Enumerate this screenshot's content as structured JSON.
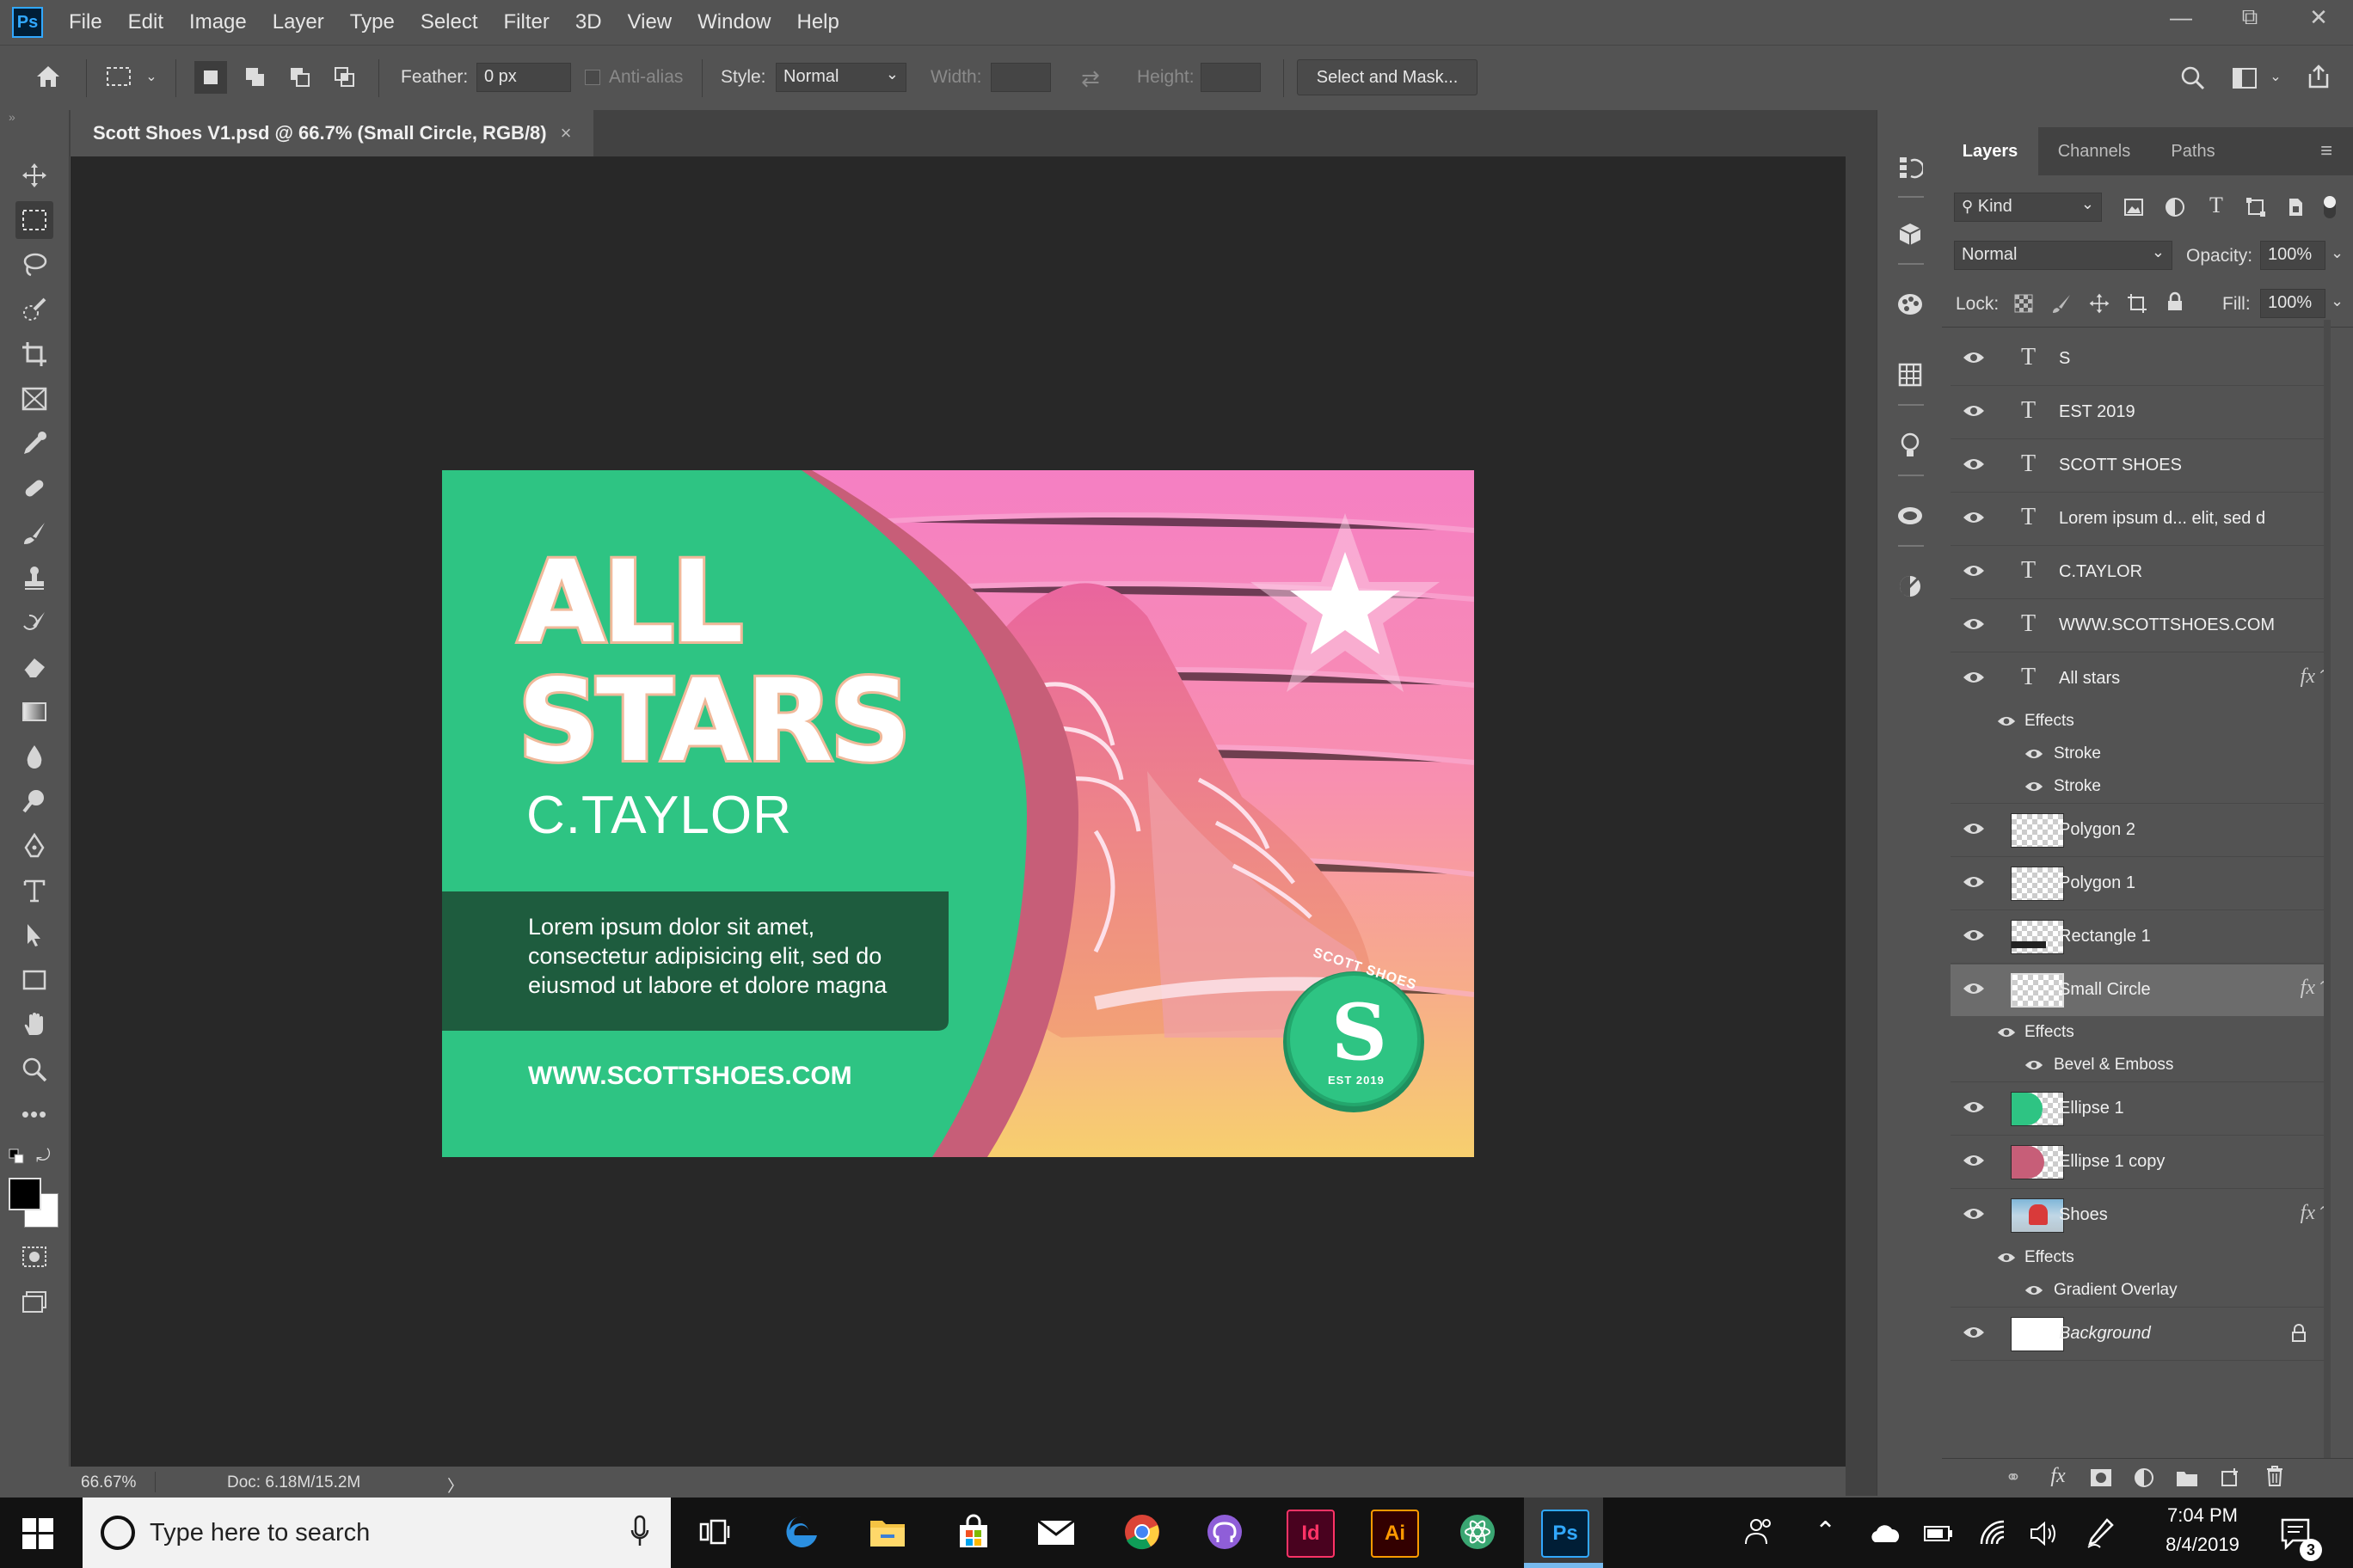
{
  "app": {
    "logo": "Ps",
    "menu": [
      "File",
      "Edit",
      "Image",
      "Layer",
      "Type",
      "Select",
      "Filter",
      "3D",
      "View",
      "Window",
      "Help"
    ]
  },
  "window_controls": {
    "minimize": "—",
    "restore": "⧉",
    "close": "✕"
  },
  "options": {
    "feather_label": "Feather:",
    "feather_value": "0 px",
    "antialias_label": "Anti-alias",
    "style_label": "Style:",
    "style_value": "Normal",
    "width_label": "Width:",
    "height_label": "Height:",
    "select_mask_label": "Select and Mask..."
  },
  "document": {
    "tab_title": "Scott Shoes V1.psd @ 66.7% (Small Circle, RGB/8)",
    "close": "×"
  },
  "artwork": {
    "headline_1": "ALL",
    "headline_2": "STARS",
    "subhead": "C.TAYLOR",
    "body_line_1": "Lorem ipsum dolor sit amet,",
    "body_line_2": "consectetur adipisicing elit, sed do",
    "body_line_3": "eiusmod ut labore et dolore magna",
    "url": "WWW.SCOTTSHOES.COM",
    "badge_top": "SCOTT SHOES",
    "badge_letter": "S",
    "badge_bottom": "EST 2019",
    "colors": {
      "green": "#2ec483",
      "dark_green": "#1e5c3e",
      "rose": "#c75e78",
      "pink": "#f57fbf",
      "yellow": "#f6c770"
    }
  },
  "status": {
    "zoom": "66.67%",
    "doc": "Doc: 6.18M/15.2M",
    "arrow": "〉"
  },
  "panel": {
    "tabs": [
      "Layers",
      "Channels",
      "Paths"
    ],
    "kind_label": "Kind",
    "blend_mode": "Normal",
    "opacity_label": "Opacity:",
    "opacity_value": "100%",
    "lock_label": "Lock:",
    "fill_label": "Fill:",
    "fill_value": "100%"
  },
  "layers": [
    {
      "name": "S",
      "type": "text"
    },
    {
      "name": "EST 2019",
      "type": "text"
    },
    {
      "name": "SCOTT SHOES",
      "type": "text"
    },
    {
      "name": "Lorem ipsum d... elit, sed d",
      "type": "text"
    },
    {
      "name": "C.TAYLOR",
      "type": "text"
    },
    {
      "name": "WWW.SCOTTSHOES.COM",
      "type": "text"
    },
    {
      "name": "All  stars",
      "type": "text",
      "fx": "fx"
    },
    {
      "name": "Polygon 2",
      "type": "shape"
    },
    {
      "name": "Polygon 1",
      "type": "shape"
    },
    {
      "name": "Rectangle 1",
      "type": "shape"
    },
    {
      "name": "Small Circle",
      "type": "shape",
      "fx": "fx",
      "selected": true
    },
    {
      "name": "Ellipse 1",
      "type": "shape"
    },
    {
      "name": "Ellipse 1 copy",
      "type": "shape"
    },
    {
      "name": "Shoes",
      "type": "image",
      "fx": "fx"
    },
    {
      "name": "Background",
      "type": "background"
    }
  ],
  "effects": {
    "effects_label": "Effects",
    "stroke_1": "Stroke",
    "stroke_2": "Stroke",
    "bevel": "Bevel & Emboss",
    "gradient": "Gradient Overlay"
  },
  "taskbar": {
    "search_placeholder": "Type here to search",
    "time": "7:04 PM",
    "date": "8/4/2019",
    "notif_count": "3",
    "app_id": "Id",
    "app_ai": "Ai",
    "app_ps": "Ps"
  }
}
